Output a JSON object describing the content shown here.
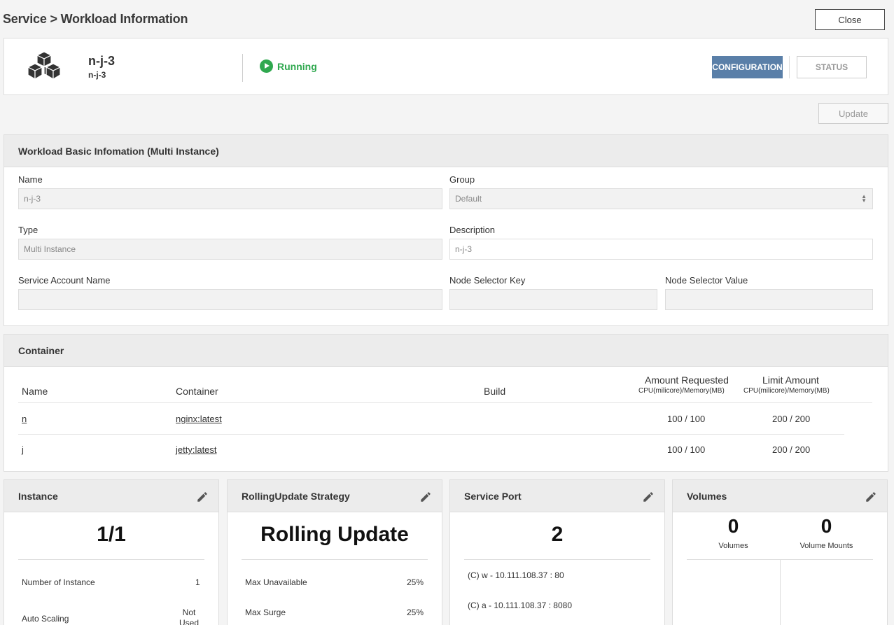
{
  "page": {
    "breadcrumb": "Service > Workload Information",
    "close_label": "Close"
  },
  "header": {
    "workload_name": "n-j-3",
    "workload_sub": "n-j-3",
    "status_text": "Running",
    "tab_configuration": "CONFIGURATION",
    "tab_status": "STATUS",
    "colors": {
      "running": "#2fa84f",
      "active_tab": "#5a7fa8"
    }
  },
  "update_label": "Update",
  "basic": {
    "title": "Workload Basic Infomation (Multi Instance)",
    "name_label": "Name",
    "name_value": "n-j-3",
    "group_label": "Group",
    "group_value": "Default",
    "type_label": "Type",
    "type_value": "Multi Instance",
    "description_label": "Description",
    "description_value": "n-j-3",
    "service_account_label": "Service Account Name",
    "service_account_value": "",
    "node_selector_key_label": "Node Selector Key",
    "node_selector_key_value": "",
    "node_selector_value_label": "Node Selector Value",
    "node_selector_value_value": ""
  },
  "container": {
    "title": "Container",
    "columns": {
      "name": "Name",
      "container": "Container",
      "build": "Build",
      "requested": "Amount Requested",
      "requested_sub": "CPU(milicore)/Memory(MB)",
      "limit": "Limit Amount",
      "limit_sub": "CPU(milicore)/Memory(MB)"
    },
    "rows": [
      {
        "name": "n",
        "container": "nginx:latest",
        "build": "",
        "requested": "100 / 100",
        "limit": "200 / 200"
      },
      {
        "name": "j",
        "container": "jetty:latest",
        "build": "",
        "requested": "100 / 100",
        "limit": "200 / 200"
      }
    ]
  },
  "instance": {
    "title": "Instance",
    "value": "1/1",
    "number_label": "Number of Instance",
    "number_value": "1",
    "auto_label": "Auto Scaling",
    "auto_value": "Not Used"
  },
  "rolling": {
    "title": "RollingUpdate Strategy",
    "value": "Rolling Update",
    "max_unavailable_label": "Max Unavailable",
    "max_unavailable_value": "25%",
    "max_surge_label": "Max Surge",
    "max_surge_value": "25%"
  },
  "service_port": {
    "title": "Service Port",
    "value": "2",
    "ports": [
      "(C) w - 10.111.108.37 : 80",
      "(C) a - 10.111.108.37 : 8080"
    ]
  },
  "volumes": {
    "title": "Volumes",
    "volumes_value": "0",
    "volumes_label": "Volumes",
    "mounts_value": "0",
    "mounts_label": "Volume Mounts"
  },
  "icons": [
    "cubes-icon",
    "play-circle-icon",
    "select-arrows-icon",
    "pencil-icon"
  ]
}
